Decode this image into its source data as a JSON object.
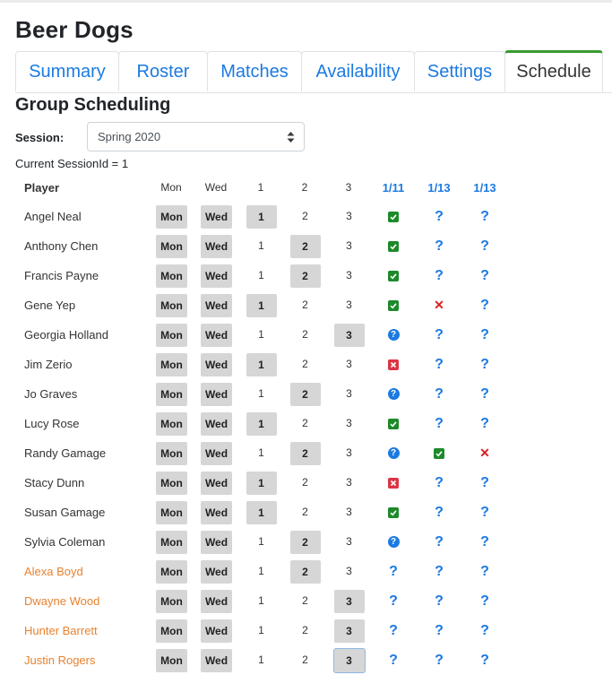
{
  "team_name": "Beer Dogs",
  "tabs": [
    "Summary",
    "Roster",
    "Matches",
    "Availability",
    "Settings",
    "Schedule"
  ],
  "section_title": "Group Scheduling",
  "session_label": "Session:",
  "session_value": "Spring 2020",
  "session_id_text": "Current SessionId = 1",
  "headers": [
    "Player",
    "Mon",
    "Wed",
    "1",
    "2",
    "3",
    "1/11",
    "1/13",
    "1/13"
  ],
  "colors": {
    "link": "#1b7ae0",
    "active_tab_border": "#3a9a32",
    "substitute": "#e8822f",
    "yes": "#1d8a2a",
    "no": "#dc3545"
  },
  "players": [
    {
      "name": "Angel Neal",
      "sub": false,
      "mon": "Mon",
      "wed": "Wed",
      "slots": [
        "1",
        "2",
        "3"
      ],
      "sel": 0,
      "avail": [
        "yes-icon",
        "unknown-icon",
        "unknown-icon"
      ]
    },
    {
      "name": "Anthony Chen",
      "sub": false,
      "mon": "Mon",
      "wed": "Wed",
      "slots": [
        "1",
        "2",
        "3"
      ],
      "sel": 1,
      "avail": [
        "yes-icon",
        "unknown-icon",
        "unknown-icon"
      ]
    },
    {
      "name": "Francis Payne",
      "sub": false,
      "mon": "Mon",
      "wed": "Wed",
      "slots": [
        "1",
        "2",
        "3"
      ],
      "sel": 1,
      "avail": [
        "yes-icon",
        "unknown-icon",
        "unknown-icon"
      ]
    },
    {
      "name": "Gene Yep",
      "sub": false,
      "mon": "Mon",
      "wed": "Wed",
      "slots": [
        "1",
        "2",
        "3"
      ],
      "sel": 0,
      "avail": [
        "yes-icon",
        "x-icon",
        "unknown-icon"
      ]
    },
    {
      "name": "Georgia Holland",
      "sub": false,
      "mon": "Mon",
      "wed": "Wed",
      "slots": [
        "1",
        "2",
        "3"
      ],
      "sel": 2,
      "avail": [
        "maybe-icon",
        "unknown-icon",
        "unknown-icon"
      ]
    },
    {
      "name": "Jim Zerio",
      "sub": false,
      "mon": "Mon",
      "wed": "Wed",
      "slots": [
        "1",
        "2",
        "3"
      ],
      "sel": 0,
      "avail": [
        "no-icon",
        "unknown-icon",
        "unknown-icon"
      ]
    },
    {
      "name": "Jo Graves",
      "sub": false,
      "mon": "Mon",
      "wed": "Wed",
      "slots": [
        "1",
        "2",
        "3"
      ],
      "sel": 1,
      "avail": [
        "maybe-icon",
        "unknown-icon",
        "unknown-icon"
      ]
    },
    {
      "name": "Lucy Rose",
      "sub": false,
      "mon": "Mon",
      "wed": "Wed",
      "slots": [
        "1",
        "2",
        "3"
      ],
      "sel": 0,
      "avail": [
        "yes-icon",
        "unknown-icon",
        "unknown-icon"
      ]
    },
    {
      "name": "Randy Gamage",
      "sub": false,
      "mon": "Mon",
      "wed": "Wed",
      "slots": [
        "1",
        "2",
        "3"
      ],
      "sel": 1,
      "avail": [
        "maybe-icon",
        "yes-icon",
        "x-icon"
      ]
    },
    {
      "name": "Stacy Dunn",
      "sub": false,
      "mon": "Mon",
      "wed": "Wed",
      "slots": [
        "1",
        "2",
        "3"
      ],
      "sel": 0,
      "avail": [
        "no-icon",
        "unknown-icon",
        "unknown-icon"
      ]
    },
    {
      "name": "Susan Gamage",
      "sub": false,
      "mon": "Mon",
      "wed": "Wed",
      "slots": [
        "1",
        "2",
        "3"
      ],
      "sel": 0,
      "avail": [
        "yes-icon",
        "unknown-icon",
        "unknown-icon"
      ]
    },
    {
      "name": "Sylvia Coleman",
      "sub": false,
      "mon": "Mon",
      "wed": "Wed",
      "slots": [
        "1",
        "2",
        "3"
      ],
      "sel": 1,
      "avail": [
        "maybe-icon",
        "unknown-icon",
        "unknown-icon"
      ]
    },
    {
      "name": "Alexa Boyd",
      "sub": true,
      "mon": "Mon",
      "wed": "Wed",
      "slots": [
        "1",
        "2",
        "3"
      ],
      "sel": 1,
      "avail": [
        "unknown-icon",
        "unknown-icon",
        "unknown-icon"
      ]
    },
    {
      "name": "Dwayne Wood",
      "sub": true,
      "mon": "Mon",
      "wed": "Wed",
      "slots": [
        "1",
        "2",
        "3"
      ],
      "sel": 2,
      "avail": [
        "unknown-icon",
        "unknown-icon",
        "unknown-icon"
      ]
    },
    {
      "name": "Hunter Barrett",
      "sub": true,
      "mon": "Mon",
      "wed": "Wed",
      "slots": [
        "1",
        "2",
        "3"
      ],
      "sel": 2,
      "avail": [
        "unknown-icon",
        "unknown-icon",
        "unknown-icon"
      ]
    },
    {
      "name": "Justin Rogers",
      "sub": true,
      "mon": "Mon",
      "wed": "Wed",
      "slots": [
        "1",
        "2",
        "3"
      ],
      "sel": 2,
      "avail": [
        "unknown-icon",
        "unknown-icon",
        "unknown-icon"
      ],
      "focused": 2
    }
  ]
}
